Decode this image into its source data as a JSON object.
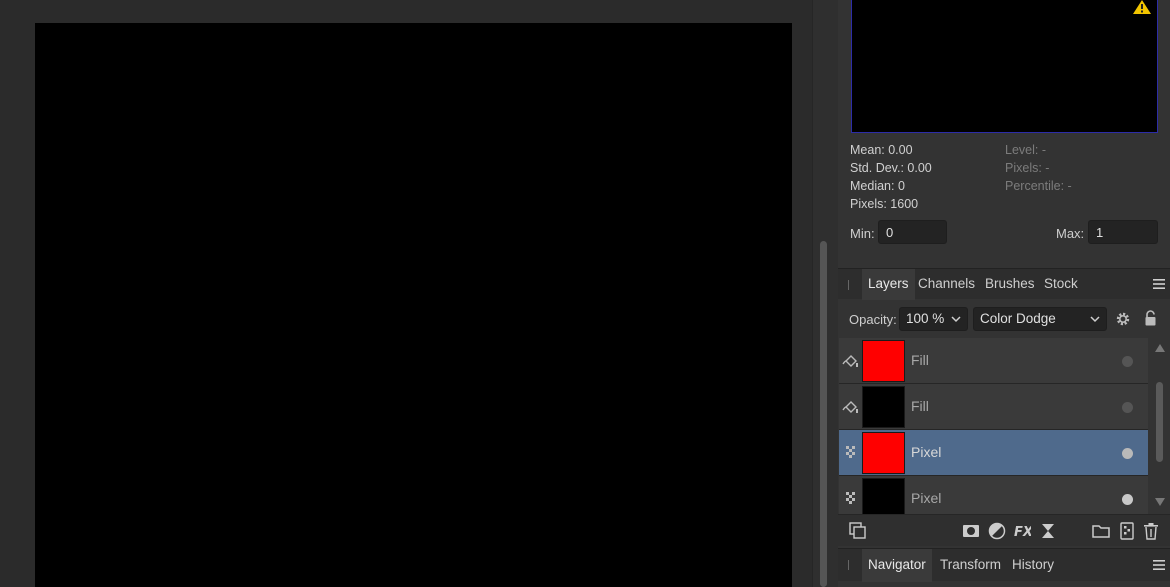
{
  "histogram": {
    "mean": "Mean: 0.00",
    "std_dev": "Std. Dev.: 0.00",
    "median": "Median: 0",
    "pixels": "Pixels: 1600",
    "level": "Level: -",
    "pixels_right": "Pixels: -",
    "percentile": "Percentile: -",
    "min_label": "Min:",
    "min_value": "0",
    "max_label": "Max:",
    "max_value": "1",
    "warning_icon": "warning-icon"
  },
  "layers_panel": {
    "tabs": [
      "Layers",
      "Channels",
      "Brushes",
      "Stock"
    ],
    "active_tab": "Layers",
    "opacity_label": "Opacity:",
    "opacity_value": "100 %",
    "blend_mode": "Color Dodge",
    "layers": [
      {
        "name": "Fill",
        "type": "fill",
        "thumb_color": "#ff0000",
        "selected": false
      },
      {
        "name": "Fill",
        "type": "fill",
        "thumb_color": "#000000",
        "selected": false
      },
      {
        "name": "Pixel",
        "type": "pixel",
        "thumb_color": "#ff0000",
        "selected": true
      },
      {
        "name": "Pixel",
        "type": "pixel",
        "thumb_color": "#000000",
        "selected": false
      }
    ]
  },
  "bottom_panel": {
    "tabs": [
      "Navigator",
      "Transform",
      "History"
    ],
    "active_tab": "Navigator"
  },
  "colors": {
    "selection": "#4f6a8c",
    "canvas": "#000000",
    "panel": "#333333"
  }
}
